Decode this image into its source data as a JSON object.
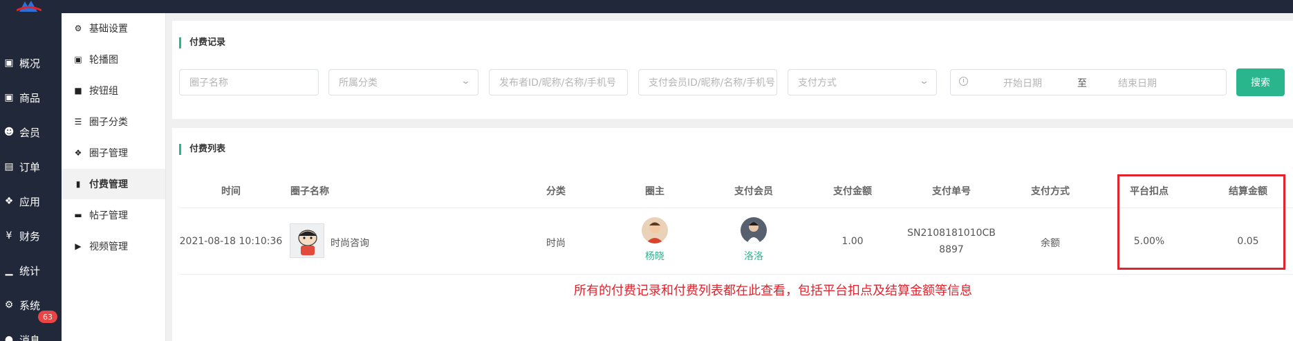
{
  "left_nav": {
    "items": [
      {
        "label": "概况",
        "icon": "card-icon"
      },
      {
        "label": "商品",
        "icon": "card-icon"
      },
      {
        "label": "会员",
        "icon": "users-icon"
      },
      {
        "label": "订单",
        "icon": "cart-icon"
      },
      {
        "label": "应用",
        "icon": "cubes-icon"
      },
      {
        "label": "财务",
        "icon": "yen-icon"
      },
      {
        "label": "统计",
        "icon": "bar-chart-icon"
      },
      {
        "label": "系统",
        "icon": "gears-icon"
      },
      {
        "label": "消息",
        "icon": "comment-icon"
      }
    ],
    "message_badge": "63"
  },
  "sub_nav": {
    "items": [
      {
        "label": "基础设置",
        "icon": "gears-icon"
      },
      {
        "label": "轮播图",
        "icon": "image-icon"
      },
      {
        "label": "按钮组",
        "icon": "square-icon"
      },
      {
        "label": "圈子分类",
        "icon": "list-icon"
      },
      {
        "label": "圈子管理",
        "icon": "cubes-icon"
      },
      {
        "label": "付费管理",
        "icon": "bookmark-icon",
        "active": true
      },
      {
        "label": "帖子管理",
        "icon": "folder-icon"
      },
      {
        "label": "视频管理",
        "icon": "video-icon"
      }
    ]
  },
  "filter": {
    "title": "付费记录",
    "circle_name_placeholder": "圈子名称",
    "category_placeholder": "所属分类",
    "publisher_placeholder": "发布者ID/昵称/名称/手机号",
    "member_placeholder": "支付会员ID/昵称/名称/手机号",
    "pay_method_placeholder": "支付方式",
    "start_date_placeholder": "开始日期",
    "range_separator": "至",
    "end_date_placeholder": "结束日期",
    "search_label": "搜索"
  },
  "table": {
    "title": "付费列表",
    "columns": [
      "时间",
      "圈子名称",
      "分类",
      "圈主",
      "支付会员",
      "支付金额",
      "支付单号",
      "支付方式",
      "平台扣点",
      "结算金额"
    ],
    "rows": [
      {
        "time": "2021-08-18 10:10:36",
        "circle_name": "时尚咨询",
        "category": "时尚",
        "owner": "杨晓",
        "member": "洛洛",
        "amount": "1.00",
        "order_no_line1": "SN2108181010CB",
        "order_no_line2": "8897",
        "pay_method": "余额",
        "platform_fee": "5.00%",
        "settle_amount": "0.05"
      }
    ]
  },
  "annotation_note": "所有的付费记录和付费列表都在此查看，包括平台扣点及结算金额等信息",
  "colors": {
    "sidebar_bg": "#20283a",
    "accent_green": "#2ab68c",
    "highlight_red": "#e2222c",
    "badge_red": "#e84545"
  }
}
